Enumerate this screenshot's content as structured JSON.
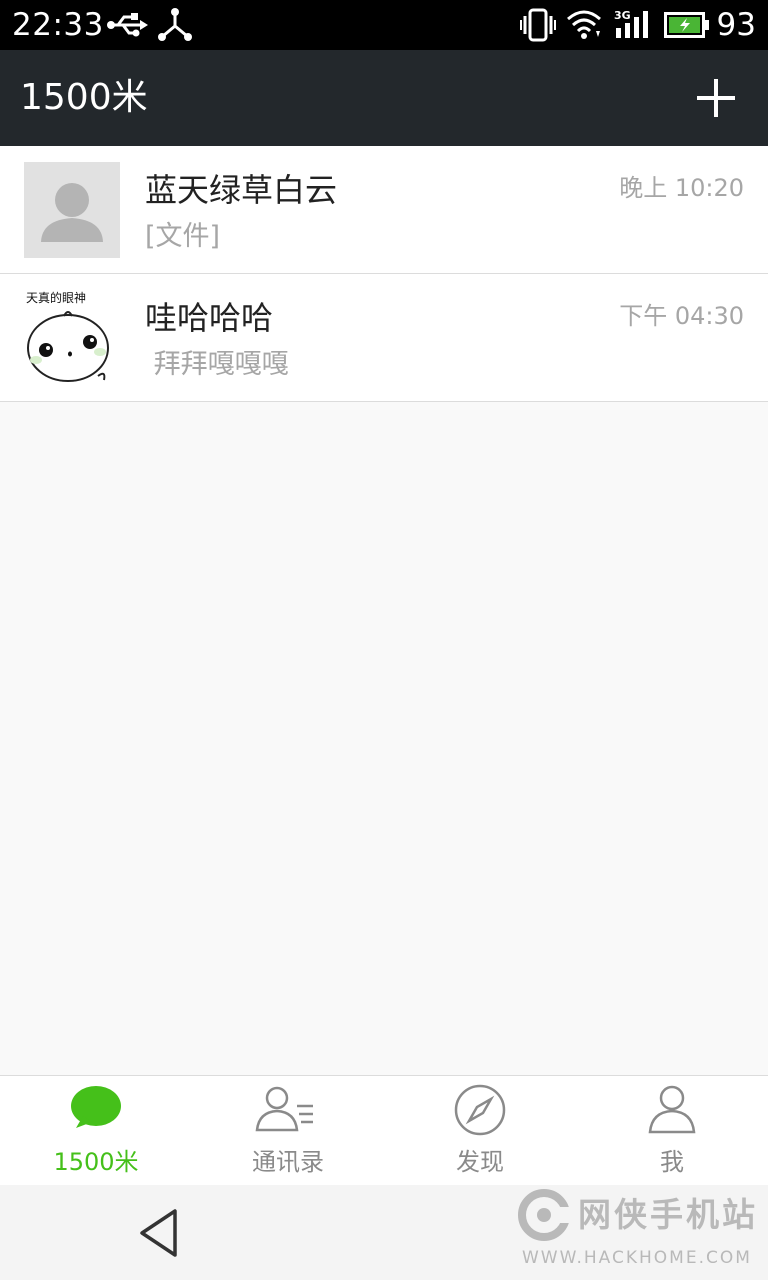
{
  "status_bar": {
    "time": "22:33",
    "battery_level": "93",
    "network_type": "3G",
    "icons": [
      "usb-icon",
      "share-icon",
      "vibrate-icon",
      "wifi-icon",
      "signal-icon",
      "battery-charging-icon"
    ]
  },
  "header": {
    "title": "1500米",
    "add_icon": "plus-icon"
  },
  "chats": [
    {
      "name": "蓝天绿草白云",
      "time": "晚上 10:20",
      "message": "[文件]",
      "avatar": "default-avatar-icon"
    },
    {
      "name": "哇哈哈哈",
      "time": "下午 04:30",
      "message": " 拜拜嘎嘎嘎",
      "avatar": "cartoon-avatar",
      "avatar_caption": "天真的眼神"
    }
  ],
  "tabs": [
    {
      "label": "1500米",
      "icon": "chat-bubble-icon",
      "active": true
    },
    {
      "label": "通讯录",
      "icon": "contacts-icon",
      "active": false
    },
    {
      "label": "发现",
      "icon": "compass-icon",
      "active": false
    },
    {
      "label": "我",
      "icon": "person-icon",
      "active": false
    }
  ],
  "watermark": {
    "text": "网侠手机站",
    "url": "WWW.HACKHOME.COM"
  },
  "colors": {
    "header_bg": "#23282c",
    "accent": "#45c01a",
    "muted_text": "#a6a6a6"
  }
}
